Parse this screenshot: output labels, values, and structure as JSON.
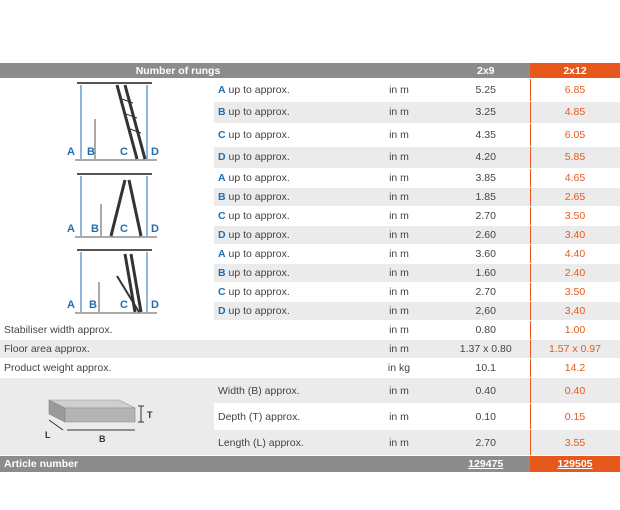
{
  "header": {
    "title": "Number of rungs",
    "col1": "2x9",
    "col2": "2x12"
  },
  "rows": [
    {
      "letter": "A",
      "text": "up to approx.",
      "unit": "in m",
      "v1": "5.25",
      "v2": "6.85"
    },
    {
      "letter": "B",
      "text": "up to approx.",
      "unit": "in m",
      "v1": "3.25",
      "v2": "4.85"
    },
    {
      "letter": "C",
      "text": "up to approx.",
      "unit": "in m",
      "v1": "4.35",
      "v2": "6.05"
    },
    {
      "letter": "D",
      "text": "up to approx.",
      "unit": "in m",
      "v1": "4.20",
      "v2": "5.85"
    },
    {
      "letter": "A",
      "text": "up to approx.",
      "unit": "in m",
      "v1": "3.85",
      "v2": "4.65"
    },
    {
      "letter": "B",
      "text": "up to approx.",
      "unit": "in m",
      "v1": "1.85",
      "v2": "2.65"
    },
    {
      "letter": "C",
      "text": "up to approx.",
      "unit": "in m",
      "v1": "2.70",
      "v2": "3.50"
    },
    {
      "letter": "D",
      "text": "up to approx.",
      "unit": "in m",
      "v1": "2.60",
      "v2": "3.40"
    },
    {
      "letter": "A",
      "text": "up to approx.",
      "unit": "in m",
      "v1": "3.60",
      "v2": "4.40"
    },
    {
      "letter": "B",
      "text": "up to approx.",
      "unit": "in m",
      "v1": "1.60",
      "v2": "2.40"
    },
    {
      "letter": "C",
      "text": "up to approx.",
      "unit": "in m",
      "v1": "2.70",
      "v2": "3.50"
    },
    {
      "letter": "D",
      "text": "up to approx.",
      "unit": "in m",
      "v1": "2,60",
      "v2": "3,40"
    }
  ],
  "general": [
    {
      "label": "Stabiliser width approx.",
      "unit": "in m",
      "v1": "0.80",
      "v2": "1.00"
    },
    {
      "label": "Floor area approx.",
      "unit": "in m",
      "v1": "1.37 x 0.80",
      "v2": "1.57 x 0.97"
    },
    {
      "label": "Product weight approx.",
      "unit": "in kg",
      "v1": "10.1",
      "v2": "14.2"
    }
  ],
  "package": [
    {
      "label": "Width (B) approx.",
      "unit": "in m",
      "v1": "0.40",
      "v2": "0.40"
    },
    {
      "label": "Depth (T) approx.",
      "unit": "in m",
      "v1": "0.10",
      "v2": "0.15"
    },
    {
      "label": "Length (L) approx.",
      "unit": "in m",
      "v1": "2.70",
      "v2": "3.55"
    }
  ],
  "diagram_labels": {
    "a": "A",
    "b": "B",
    "c": "C",
    "d": "D",
    "t": "T",
    "l": "L",
    "w": "B"
  },
  "footer": {
    "label": "Article number",
    "art1": "129475",
    "art2": "129505"
  },
  "colors": {
    "accent": "#e8581c",
    "header": "#8c8c8c",
    "stripe": "#ebebeb",
    "letter": "#1f6fb5"
  }
}
